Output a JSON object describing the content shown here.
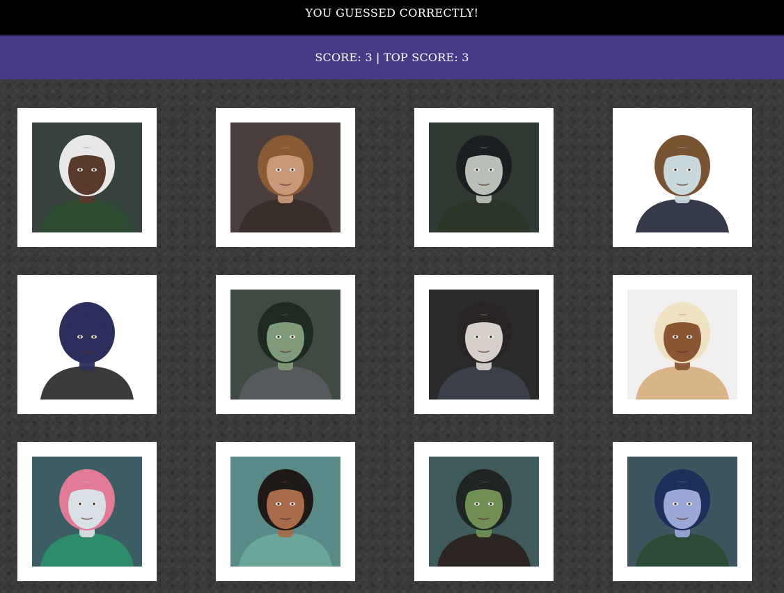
{
  "header": {
    "message": "YOU GUESSED CORRECTLY!"
  },
  "scoreboard": {
    "text": "SCORE: 3 | TOP SCORE: 3"
  },
  "cards": [
    {
      "icon": "portrait-white-haired-elder",
      "bg": "#36433c",
      "skin": "#5a3a2a",
      "hair": "#e8e8e8",
      "cloth": "#2f4a33"
    },
    {
      "icon": "portrait-bearded-man-fur-collar",
      "bg": "#4a3f3d",
      "skin": "#c9987a",
      "hair": "#8a5a35",
      "cloth": "#3a2e2a"
    },
    {
      "icon": "portrait-dark-haired-elf",
      "bg": "#2f3a33",
      "skin": "#b9bfb6",
      "hair": "#1c1f22",
      "cloth": "#2b3626"
    },
    {
      "icon": "portrait-goblin-in-suit",
      "bg": "#ffffff",
      "skin": "#c8d8dc",
      "hair": "#7a5333",
      "cloth": "#353a4a"
    },
    {
      "icon": "portrait-raven-in-cloak",
      "bg": "#ffffff",
      "skin": "#2c2f5c",
      "hair": "#2c2f5c",
      "cloth": "#3a3a3d"
    },
    {
      "icon": "portrait-hooded-green-goblin",
      "bg": "#3e4a42",
      "skin": "#7e9a78",
      "hair": "#1d2a22",
      "cloth": "#555a5c"
    },
    {
      "icon": "portrait-braided-woman",
      "bg": "#2a2a2d",
      "skin": "#d7cfc9",
      "hair": "#2a2524",
      "cloth": "#3a3f4a"
    },
    {
      "icon": "portrait-blonde-woman-flower-crown",
      "bg": "#f2f0ee",
      "skin": "#8a5634",
      "hair": "#efe2c2",
      "cloth": "#d9b489"
    },
    {
      "icon": "portrait-pink-haired-ram-folk",
      "bg": "#3b5d63",
      "skin": "#d9dfe6",
      "hair": "#e07a97",
      "cloth": "#2f8c6a"
    },
    {
      "icon": "portrait-woman-hair-bun",
      "bg": "#5a8a88",
      "skin": "#a86c4a",
      "hair": "#1f1a17",
      "cloth": "#6aa79a"
    },
    {
      "icon": "portrait-green-half-orc",
      "bg": "#3f5a5a",
      "skin": "#6f8f55",
      "hair": "#1f2523",
      "cloth": "#2c2421"
    },
    {
      "icon": "portrait-blue-tiefling",
      "bg": "#3e5560",
      "skin": "#9aa8d6",
      "hair": "#1e2f5a",
      "cloth": "#2d4a36"
    }
  ]
}
